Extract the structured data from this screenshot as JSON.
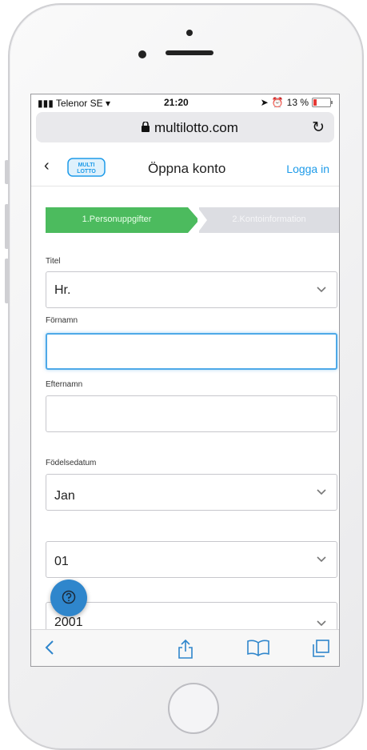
{
  "status": {
    "carrier": "Telenor SE",
    "time": "21:20",
    "battery": "13 %"
  },
  "browser": {
    "url": "multilotto.com"
  },
  "nav": {
    "title": "Öppna konto",
    "login": "Logga in",
    "logo_text_1": "MULTI",
    "logo_text_2": "LOTTO"
  },
  "steps": [
    {
      "label": "1.Personuppgifter",
      "active": true
    },
    {
      "label": "2.Kontoinformation",
      "active": false
    }
  ],
  "form": {
    "title_label": "Titel",
    "title_value": "Hr.",
    "firstname_label": "Förnamn",
    "firstname_value": "",
    "lastname_label": "Efternamn",
    "lastname_value": "",
    "birthdate_label": "Födelsedatum",
    "month_value": "Jan",
    "day_value": "01",
    "year_value": "2001"
  },
  "colors": {
    "accent": "#4cbb5e",
    "link": "#1e9be9",
    "help": "#2f86cc",
    "focus": "#4ea9e8"
  }
}
